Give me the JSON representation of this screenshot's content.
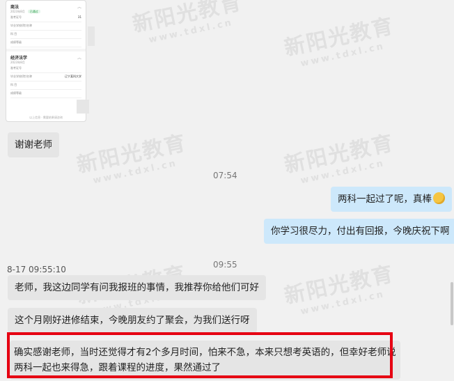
{
  "watermark": {
    "brand": "新阳光教育",
    "domain": "www.tdxl.cn"
  },
  "screenshot_card": {
    "sections": [
      {
        "title": "商法",
        "subtitle": "2023年8月",
        "status": "已通过",
        "rows": [
          {
            "label": "准考证号",
            "value": "31"
          },
          {
            "label": "毕业学校(院)名称",
            "value": ""
          },
          {
            "label": "科  目",
            "value": ""
          },
          {
            "label": "成绩等级",
            "value": ""
          }
        ]
      },
      {
        "title": "经济法学",
        "subtitle": "2023年8月",
        "status": "",
        "rows": [
          {
            "label": "准考证号",
            "value": ""
          },
          {
            "label": "毕业学校(院)名称",
            "value": "辽宁某科大学"
          },
          {
            "label": "科  目",
            "value": ""
          },
          {
            "label": "成绩等级",
            "value": ""
          }
        ]
      }
    ],
    "footer": "以上信息 · 需要结果请咨询"
  },
  "messages": [
    {
      "side": "left",
      "text": "谢谢老师"
    },
    {
      "side": "time",
      "text": "07:54"
    },
    {
      "side": "right",
      "text": "两科一起过了呢，真棒",
      "emoji": "thinking-face"
    },
    {
      "side": "right",
      "text": "你学习很尽力，付出有回报，今晚庆祝下啊"
    },
    {
      "side": "stamp",
      "text": "8-17 09:55:10"
    },
    {
      "side": "time",
      "text": "09:55"
    },
    {
      "side": "left",
      "text": "老师，我这边同学有问我报班的事情，我推荐你给他们可好"
    },
    {
      "side": "left",
      "text": "这个月刚好进修结束，今晚朋友约了聚会，为我们送行呀"
    },
    {
      "side": "left",
      "text_line1": "确实感谢老师，当时还觉得才有2个多月时间，怕来不急，本来只想考英语的，但幸好老师说",
      "text_line2": "两科一起也来得急，跟着课程的进度，果然通过了"
    }
  ],
  "colors": {
    "left_bubble": "#e5e5e5",
    "right_bubble": "#cde8fb",
    "highlight": "#e60012"
  }
}
